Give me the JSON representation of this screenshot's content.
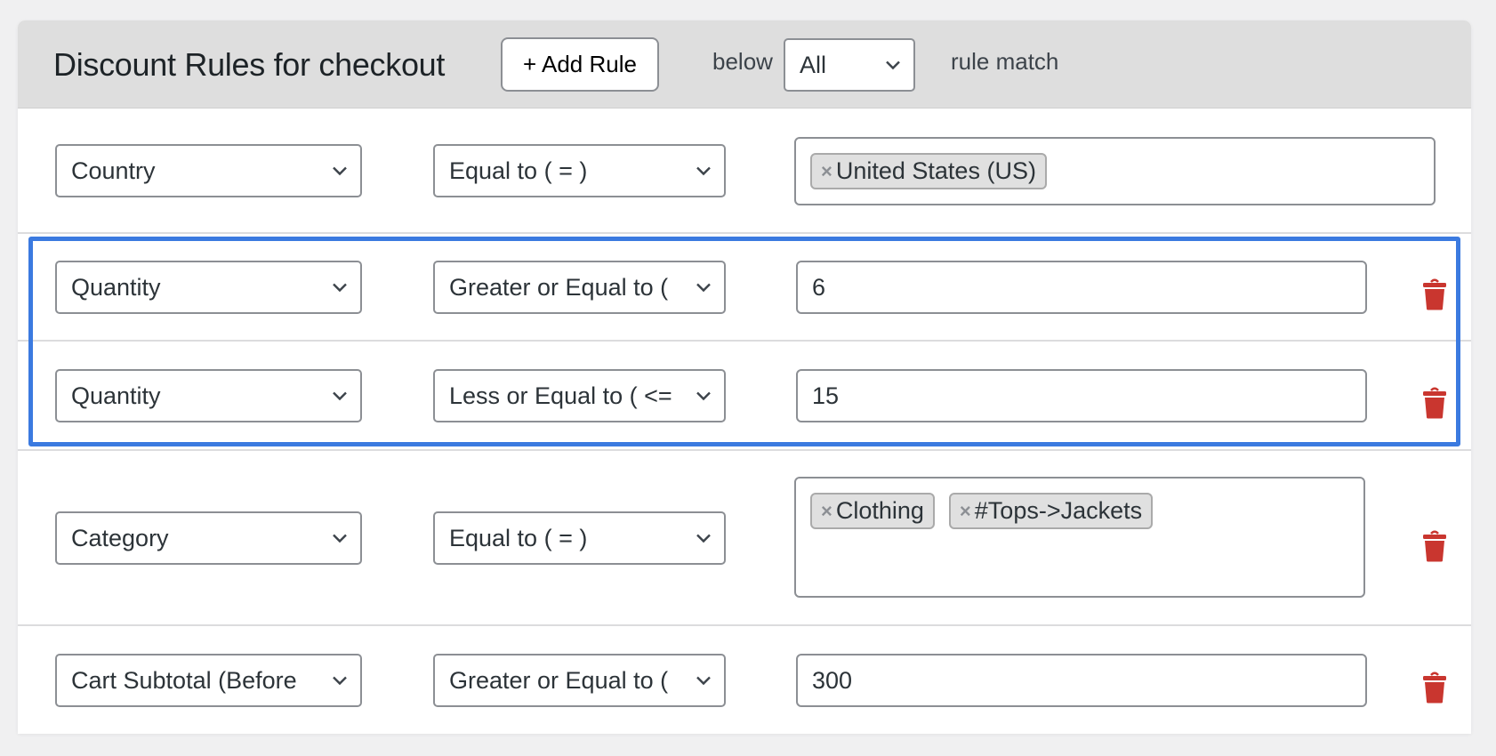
{
  "header": {
    "title": "Discount Rules for checkout",
    "add_rule_label": "+ Add Rule",
    "below_label": "below",
    "match_select_value": "All",
    "rule_match_label": "rule match"
  },
  "colors": {
    "group_highlight": "#3b7ae0",
    "delete_icon": "#c9362f",
    "header_bg": "#dedede"
  },
  "rules": [
    {
      "type": "Country",
      "operator": "Equal to ( = )",
      "value_kind": "tags",
      "tags": [
        "United States (US)"
      ],
      "deletable": false
    },
    {
      "type": "Quantity",
      "operator": "Greater or Equal to (",
      "value_kind": "text",
      "value": "6",
      "deletable": true,
      "grouped": true
    },
    {
      "type": "Quantity",
      "operator": "Less or Equal to ( <=",
      "value_kind": "text",
      "value": "15",
      "deletable": true,
      "grouped": true
    },
    {
      "type": "Category",
      "operator": "Equal to ( = )",
      "value_kind": "tags",
      "tags": [
        "Clothing",
        "#Tops->Jackets"
      ],
      "deletable": true
    },
    {
      "type": "Cart Subtotal (Before",
      "operator": "Greater or Equal to (",
      "value_kind": "text",
      "value": "300",
      "deletable": true
    }
  ],
  "icons": {
    "chevron": "chevron-down-icon",
    "delete": "trash-icon",
    "remove_tag": "×"
  }
}
